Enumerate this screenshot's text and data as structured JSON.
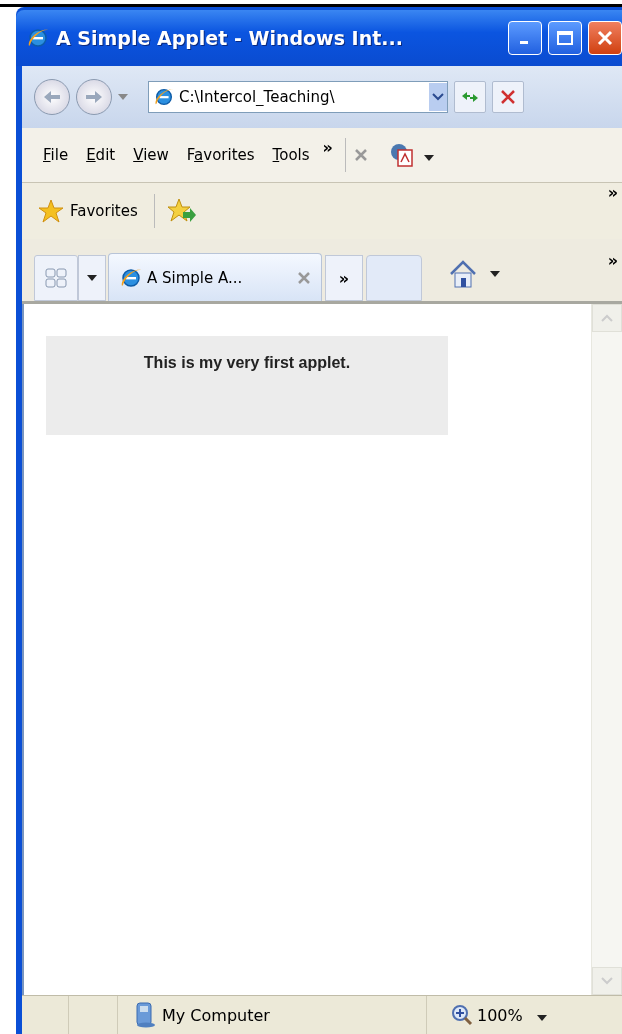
{
  "window": {
    "title": "A Simple Applet - Windows Int..."
  },
  "address": {
    "value": "C:\\Intercol_Teaching\\"
  },
  "menu": [
    {
      "access_key": "F",
      "rest": "ile"
    },
    {
      "access_key": "E",
      "rest": "dit"
    },
    {
      "access_key": "V",
      "rest": "iew"
    },
    {
      "lead": "F",
      "access_key": "a",
      "rest": "vorites"
    },
    {
      "access_key": "T",
      "rest": "ools"
    }
  ],
  "menu_overflow": "»",
  "favorites_bar": {
    "label": "Favorites",
    "overflow": "»"
  },
  "tabs": [
    {
      "label": "A Simple A...",
      "selected": true
    }
  ],
  "tabs_overflow": "»",
  "command_overflow": "»",
  "applet": {
    "text": "This is my very first applet."
  },
  "status_bar": {
    "zone": "My Computer",
    "zoom": "100%"
  }
}
